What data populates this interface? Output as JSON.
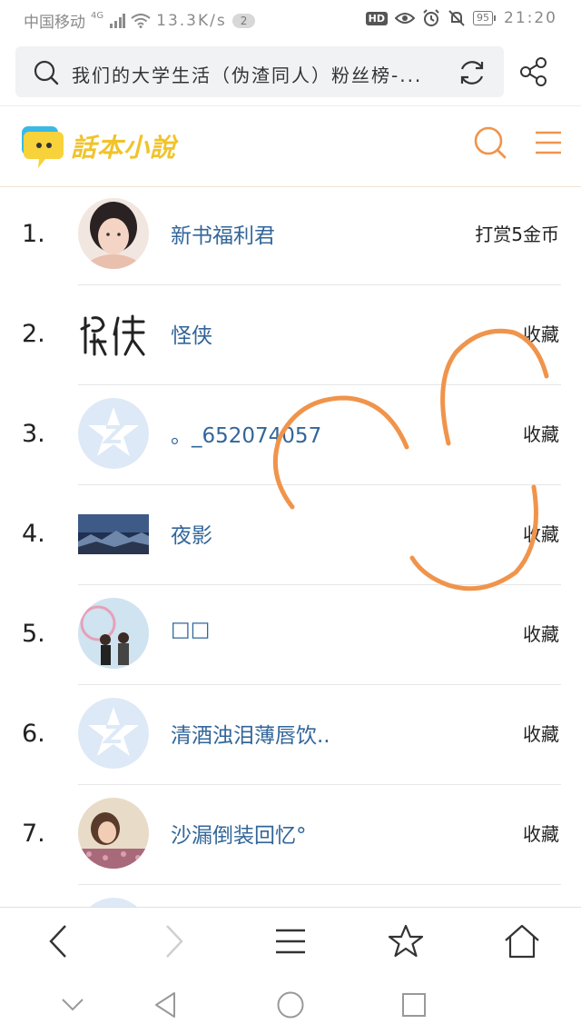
{
  "status_bar": {
    "carrier": "中国移动",
    "network": "4G",
    "speed": "13.3K/s",
    "notification_count": "2",
    "hd": "HD",
    "battery": "95",
    "time": "21:20"
  },
  "address_bar": {
    "url_text": "我们的大学生活（伪渣同人）粉丝榜-..."
  },
  "site": {
    "logo_text": "話本小說"
  },
  "ranking": [
    {
      "rank": "1.",
      "name": "新书福利君",
      "action": "打赏5金币"
    },
    {
      "rank": "2.",
      "name": "怪侠",
      "action": "收藏"
    },
    {
      "rank": "3.",
      "name": "。_652074057",
      "action": "收藏"
    },
    {
      "rank": "4.",
      "name": "夜影",
      "action": "收藏"
    },
    {
      "rank": "5.",
      "name": "□□",
      "action": "收藏"
    },
    {
      "rank": "6.",
      "name": "清酒浊泪薄唇饮..",
      "action": "收藏"
    },
    {
      "rank": "7.",
      "name": "沙漏倒装回忆°",
      "action": "收藏"
    }
  ],
  "colors": {
    "accent": "#f0944b",
    "link": "#336699",
    "logo_yellow": "#f0c32a"
  }
}
